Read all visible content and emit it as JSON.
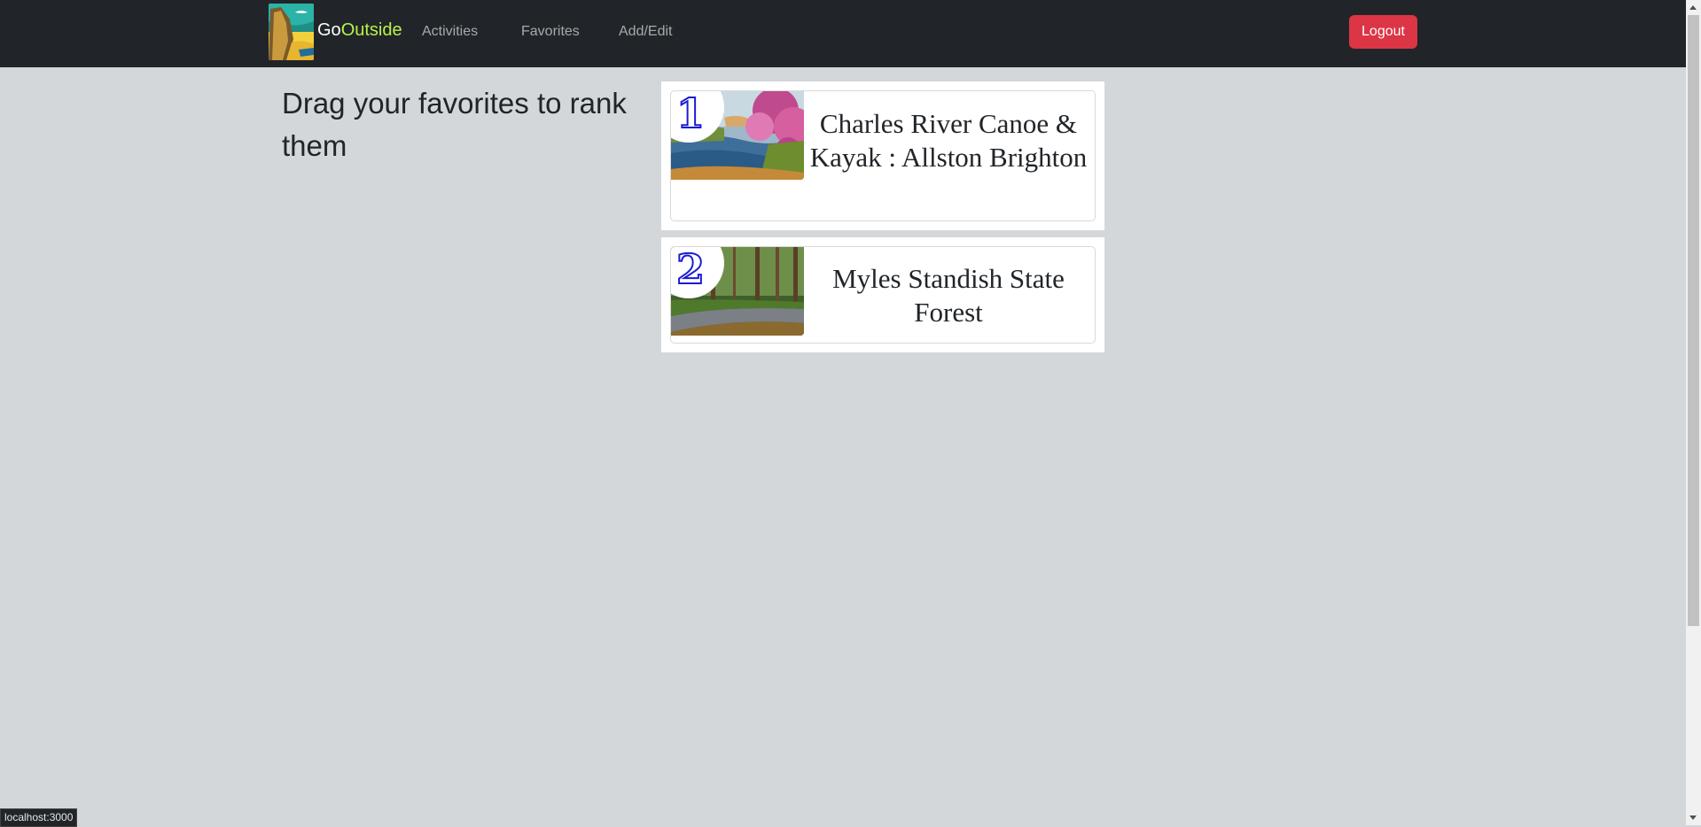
{
  "navbar": {
    "brand_go": "Go",
    "brand_outside": "Outside",
    "links": [
      "Activities",
      "Favorites",
      "Add/Edit"
    ],
    "logout_label": "Logout",
    "colors": {
      "background": "#212529",
      "brand_accent": "#b6f24a",
      "logout": "#dc3545"
    }
  },
  "main": {
    "heading": "Drag your favorites to rank them"
  },
  "favorites": [
    {
      "rank": "1",
      "title": "Charles River Canoe & Kayak : Allston Brighton"
    },
    {
      "rank": "2",
      "title": "Myles Standish State Forest"
    }
  ],
  "status_bar": {
    "url": "localhost:3000"
  }
}
